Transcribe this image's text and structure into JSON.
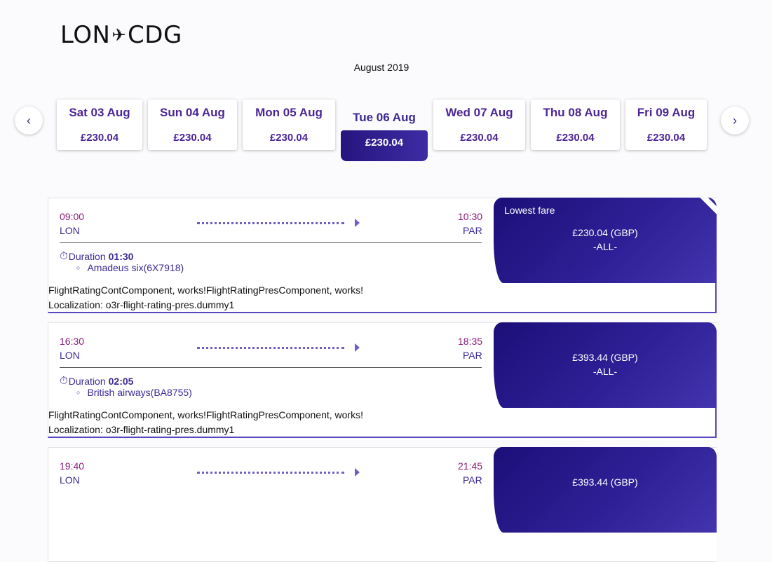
{
  "header": {
    "origin": "LON",
    "plane_glyph": "✈",
    "destination": "CDG",
    "month": "August 2019"
  },
  "nav": {
    "prev_icon": "chevron-left-icon",
    "prev_glyph": "‹",
    "next_icon": "chevron-right-icon",
    "next_glyph": "›"
  },
  "days": [
    {
      "label": "Sat 03 Aug",
      "price": "£230.04"
    },
    {
      "label": "Sun 04 Aug",
      "price": "£230.04"
    },
    {
      "label": "Mon 05 Aug",
      "price": "£230.04"
    },
    {
      "label": "Tue 06 Aug",
      "price": "£230.04"
    },
    {
      "label": "Wed 07 Aug",
      "price": "£230.04"
    },
    {
      "label": "Thu 08 Aug",
      "price": "£230.04"
    },
    {
      "label": "Fri 09 Aug",
      "price": "£230.04"
    }
  ],
  "flights": [
    {
      "dep_time": "09:00",
      "dep_city": "LON",
      "arr_time": "10:30",
      "arr_city": "PAR",
      "duration_label": "Duration",
      "duration": "01:30",
      "carrier": "Amadeus six(6X7918)",
      "badge": "Lowest fare",
      "price": "£230.04 (GBP)",
      "fare_class": "-ALL-",
      "rating_text": "FlightRatingContComponent, works!FlightRatingPresComponent, works!",
      "localization": "Localization: o3r-flight-rating-pres.dummy1"
    },
    {
      "dep_time": "16:30",
      "dep_city": "LON",
      "arr_time": "18:35",
      "arr_city": "PAR",
      "duration_label": "Duration",
      "duration": "02:05",
      "carrier": "British airways(BA8755)",
      "badge": "",
      "price": "£393.44 (GBP)",
      "fare_class": "-ALL-",
      "rating_text": "FlightRatingContComponent, works!FlightRatingPresComponent, works!",
      "localization": "Localization: o3r-flight-rating-pres.dummy1"
    },
    {
      "dep_time": "19:40",
      "dep_city": "LON",
      "arr_time": "21:45",
      "arr_city": "PAR",
      "price": "£393.44 (GBP)"
    }
  ],
  "colors": {
    "accent": "#2f1f96",
    "time": "#8a1b78",
    "text_accent": "#3b2a95"
  }
}
